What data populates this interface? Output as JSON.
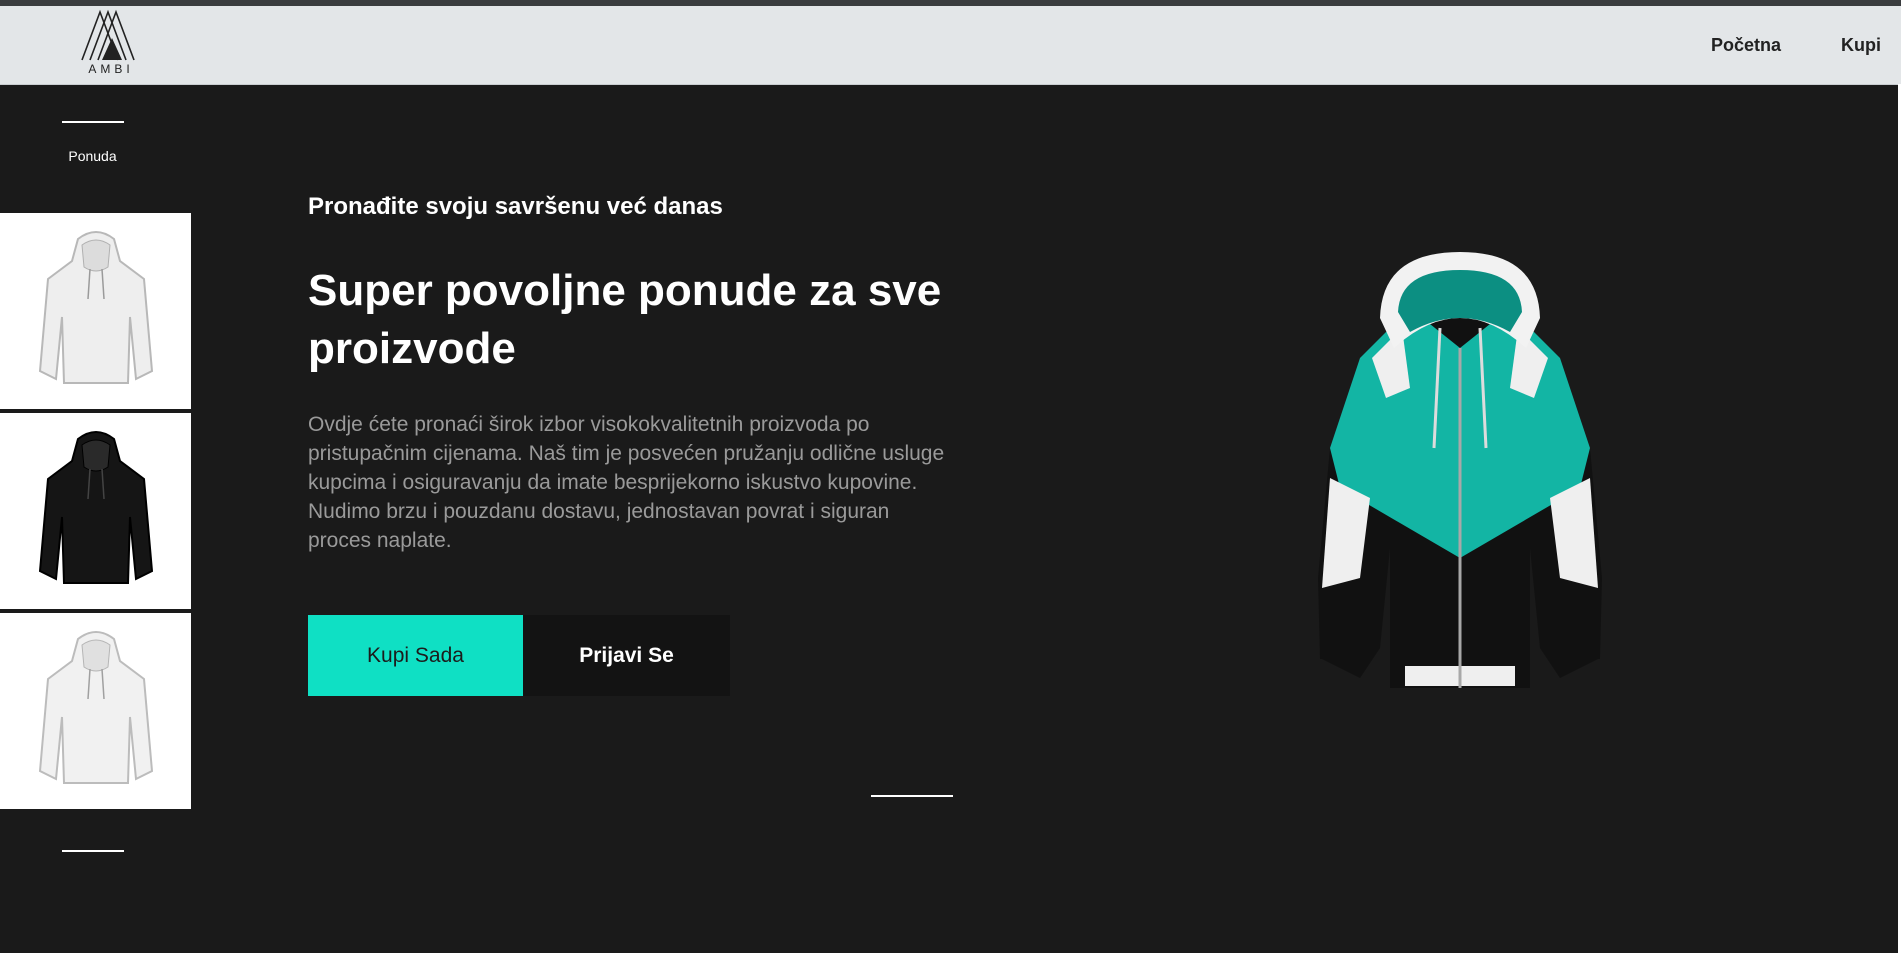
{
  "brand": {
    "logo_text": "AMBI"
  },
  "nav": {
    "items": [
      {
        "label": "Početna"
      },
      {
        "label": "Kupi"
      }
    ]
  },
  "sidebar": {
    "label": "Ponuda",
    "thumbnails": [
      {
        "icon": "white-hoodie-icon"
      },
      {
        "icon": "black-hoodie-icon"
      },
      {
        "icon": "white-hoodie-icon"
      }
    ]
  },
  "hero": {
    "kicker": "Pronađite svoju savršenu već danas",
    "headline": "Super povoljne ponude za sve proizvode",
    "description": "Ovdje ćete pronaći širok izbor visokokvalitetnih proizvoda po pristupačnim cijenama. Naš tim je posvećen pružanju odlične usluge kupcima i osiguravanju da imate besprijekorno iskustvo kupovine. Nudimo brzu i pouzdanu dostavu, jednostavan povrat i siguran proces naplate.",
    "buttons": {
      "buy": "Kupi Sada",
      "login": "Prijavi Se"
    },
    "image": {
      "icon": "teal-hoodie-icon"
    }
  },
  "colors": {
    "accent": "#0fe0c4",
    "background": "#1a1a1a",
    "header": "#e3e6e8"
  }
}
